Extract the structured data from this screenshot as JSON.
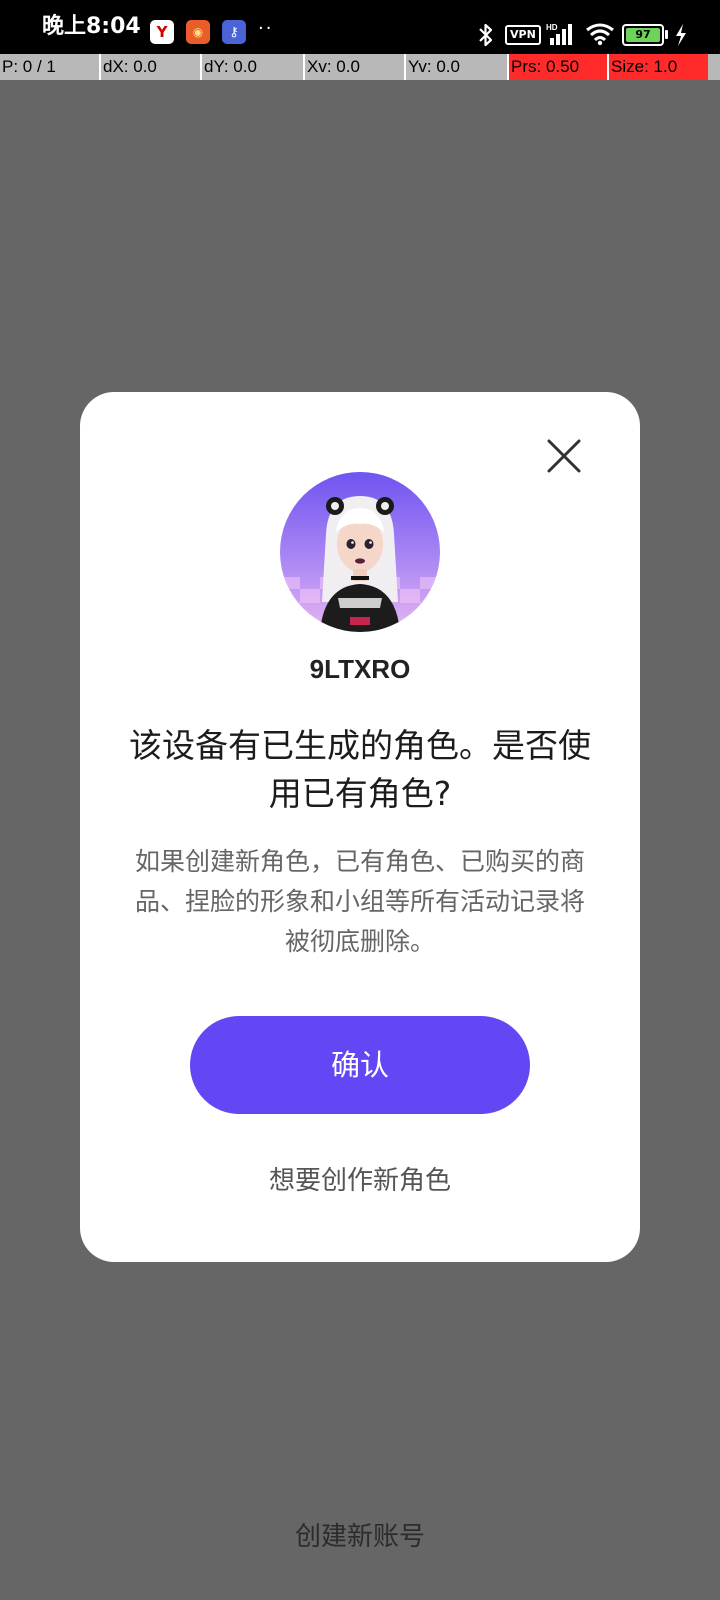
{
  "status_bar": {
    "time": "晚上8:04",
    "vpn_label": "VPN",
    "battery_level": "97",
    "app_icons": [
      "y-app-icon",
      "game-app-icon",
      "key-app-icon"
    ],
    "overflow_dots": "··"
  },
  "pointer_overlay": {
    "pointers": "P: 0 / 1",
    "dx": "dX: 0.0",
    "dy": "dY: 0.0",
    "xv": "Xv: 0.0",
    "yv": "Yv: 0.0",
    "prs": "Prs: 0.50",
    "size": "Size: 1.0"
  },
  "dialog": {
    "username": "9LTXRO",
    "title": "该设备有已生成的角色。是否使用已有角色?",
    "message": "如果创建新角色，已有角色、已购买的商品、捏脸的形象和小组等所有活动记录将被彻底删除。",
    "confirm_label": "确认",
    "create_new_label": "想要创作新角色"
  },
  "footer": {
    "create_account_label": "创建新账号"
  },
  "colors": {
    "accent": "#6346f4",
    "overlay": "#666666",
    "dialog_bg": "#ffffff"
  }
}
